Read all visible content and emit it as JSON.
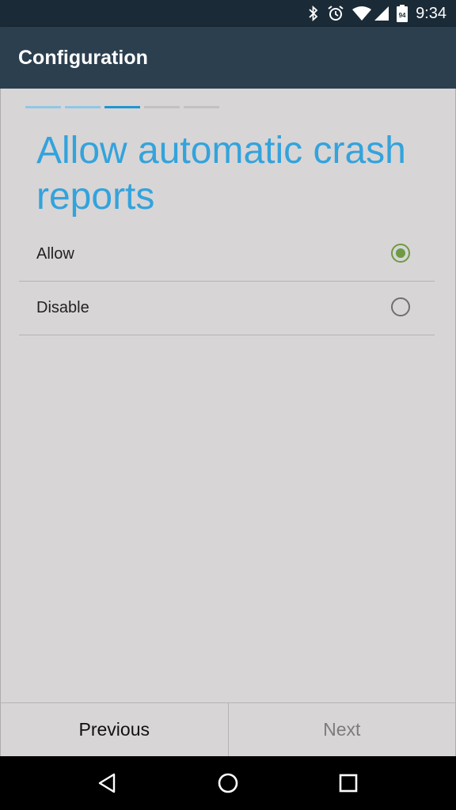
{
  "status_bar": {
    "time": "9:34",
    "battery_level": "94",
    "icons": [
      "bluetooth-icon",
      "alarm-icon",
      "wifi-icon",
      "signal-icon",
      "battery-icon"
    ]
  },
  "app_bar": {
    "title": "Configuration"
  },
  "progress": {
    "total_steps": 5,
    "current_step": 3,
    "colors": {
      "done": "#8ec8e6",
      "current": "#1e96d1",
      "pending": "#c4c0c1"
    }
  },
  "page": {
    "headline": "Allow automatic crash reports",
    "options": [
      {
        "label": "Allow",
        "checked": true
      },
      {
        "label": "Disable",
        "checked": false
      }
    ]
  },
  "bottom": {
    "previous_label": "Previous",
    "next_label": "Next"
  },
  "nav": {
    "icons": [
      "back-icon",
      "home-icon",
      "recents-icon"
    ]
  },
  "colors": {
    "accent": "#33a3dc",
    "radio_checked": "#6c9b43",
    "app_bar": "#2c3f4f",
    "status_bar": "#1a2a36"
  }
}
